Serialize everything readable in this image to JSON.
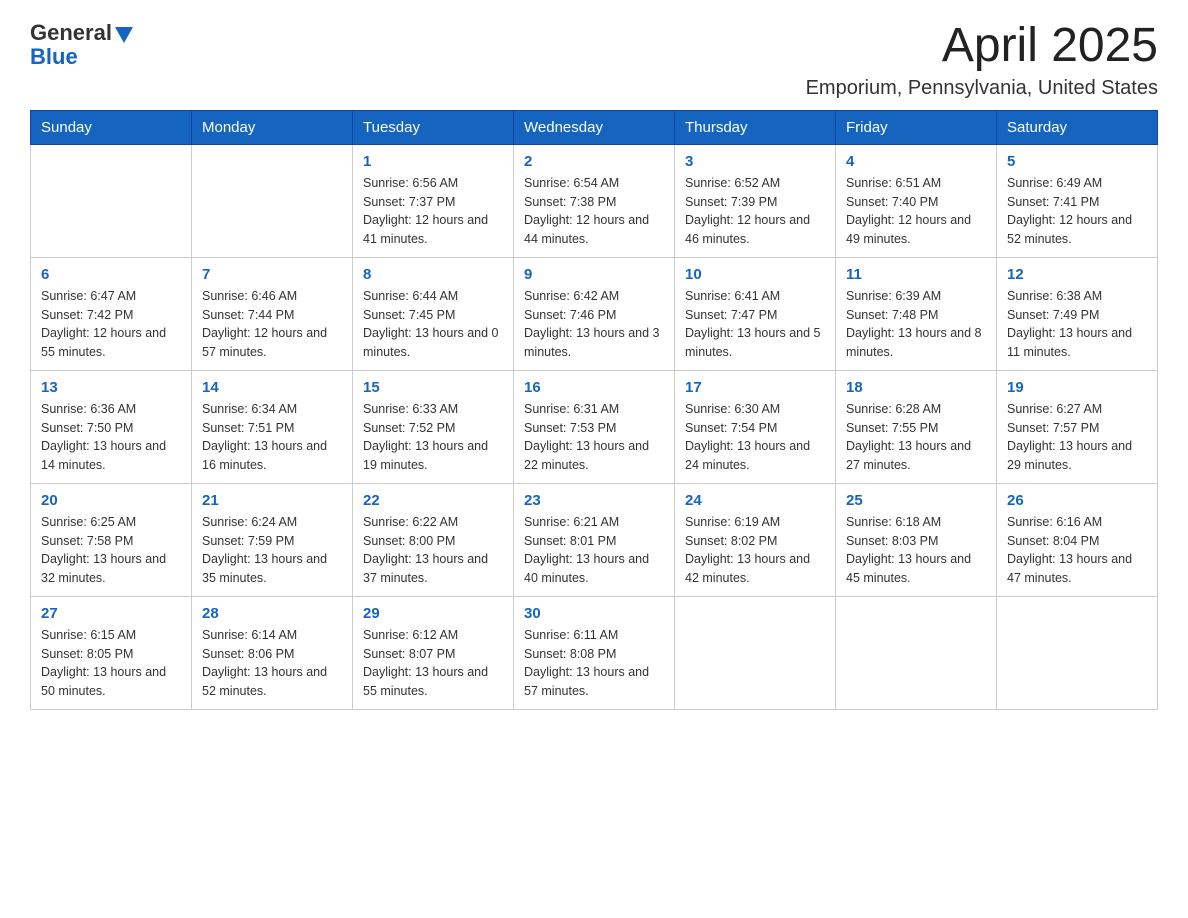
{
  "header": {
    "logo": {
      "general": "General",
      "blue": "Blue"
    },
    "month": "April 2025",
    "location": "Emporium, Pennsylvania, United States"
  },
  "weekdays": [
    "Sunday",
    "Monday",
    "Tuesday",
    "Wednesday",
    "Thursday",
    "Friday",
    "Saturday"
  ],
  "weeks": [
    [
      {
        "day": "",
        "sunrise": "",
        "sunset": "",
        "daylight": ""
      },
      {
        "day": "",
        "sunrise": "",
        "sunset": "",
        "daylight": ""
      },
      {
        "day": "1",
        "sunrise": "Sunrise: 6:56 AM",
        "sunset": "Sunset: 7:37 PM",
        "daylight": "Daylight: 12 hours and 41 minutes."
      },
      {
        "day": "2",
        "sunrise": "Sunrise: 6:54 AM",
        "sunset": "Sunset: 7:38 PM",
        "daylight": "Daylight: 12 hours and 44 minutes."
      },
      {
        "day": "3",
        "sunrise": "Sunrise: 6:52 AM",
        "sunset": "Sunset: 7:39 PM",
        "daylight": "Daylight: 12 hours and 46 minutes."
      },
      {
        "day": "4",
        "sunrise": "Sunrise: 6:51 AM",
        "sunset": "Sunset: 7:40 PM",
        "daylight": "Daylight: 12 hours and 49 minutes."
      },
      {
        "day": "5",
        "sunrise": "Sunrise: 6:49 AM",
        "sunset": "Sunset: 7:41 PM",
        "daylight": "Daylight: 12 hours and 52 minutes."
      }
    ],
    [
      {
        "day": "6",
        "sunrise": "Sunrise: 6:47 AM",
        "sunset": "Sunset: 7:42 PM",
        "daylight": "Daylight: 12 hours and 55 minutes."
      },
      {
        "day": "7",
        "sunrise": "Sunrise: 6:46 AM",
        "sunset": "Sunset: 7:44 PM",
        "daylight": "Daylight: 12 hours and 57 minutes."
      },
      {
        "day": "8",
        "sunrise": "Sunrise: 6:44 AM",
        "sunset": "Sunset: 7:45 PM",
        "daylight": "Daylight: 13 hours and 0 minutes."
      },
      {
        "day": "9",
        "sunrise": "Sunrise: 6:42 AM",
        "sunset": "Sunset: 7:46 PM",
        "daylight": "Daylight: 13 hours and 3 minutes."
      },
      {
        "day": "10",
        "sunrise": "Sunrise: 6:41 AM",
        "sunset": "Sunset: 7:47 PM",
        "daylight": "Daylight: 13 hours and 5 minutes."
      },
      {
        "day": "11",
        "sunrise": "Sunrise: 6:39 AM",
        "sunset": "Sunset: 7:48 PM",
        "daylight": "Daylight: 13 hours and 8 minutes."
      },
      {
        "day": "12",
        "sunrise": "Sunrise: 6:38 AM",
        "sunset": "Sunset: 7:49 PM",
        "daylight": "Daylight: 13 hours and 11 minutes."
      }
    ],
    [
      {
        "day": "13",
        "sunrise": "Sunrise: 6:36 AM",
        "sunset": "Sunset: 7:50 PM",
        "daylight": "Daylight: 13 hours and 14 minutes."
      },
      {
        "day": "14",
        "sunrise": "Sunrise: 6:34 AM",
        "sunset": "Sunset: 7:51 PM",
        "daylight": "Daylight: 13 hours and 16 minutes."
      },
      {
        "day": "15",
        "sunrise": "Sunrise: 6:33 AM",
        "sunset": "Sunset: 7:52 PM",
        "daylight": "Daylight: 13 hours and 19 minutes."
      },
      {
        "day": "16",
        "sunrise": "Sunrise: 6:31 AM",
        "sunset": "Sunset: 7:53 PM",
        "daylight": "Daylight: 13 hours and 22 minutes."
      },
      {
        "day": "17",
        "sunrise": "Sunrise: 6:30 AM",
        "sunset": "Sunset: 7:54 PM",
        "daylight": "Daylight: 13 hours and 24 minutes."
      },
      {
        "day": "18",
        "sunrise": "Sunrise: 6:28 AM",
        "sunset": "Sunset: 7:55 PM",
        "daylight": "Daylight: 13 hours and 27 minutes."
      },
      {
        "day": "19",
        "sunrise": "Sunrise: 6:27 AM",
        "sunset": "Sunset: 7:57 PM",
        "daylight": "Daylight: 13 hours and 29 minutes."
      }
    ],
    [
      {
        "day": "20",
        "sunrise": "Sunrise: 6:25 AM",
        "sunset": "Sunset: 7:58 PM",
        "daylight": "Daylight: 13 hours and 32 minutes."
      },
      {
        "day": "21",
        "sunrise": "Sunrise: 6:24 AM",
        "sunset": "Sunset: 7:59 PM",
        "daylight": "Daylight: 13 hours and 35 minutes."
      },
      {
        "day": "22",
        "sunrise": "Sunrise: 6:22 AM",
        "sunset": "Sunset: 8:00 PM",
        "daylight": "Daylight: 13 hours and 37 minutes."
      },
      {
        "day": "23",
        "sunrise": "Sunrise: 6:21 AM",
        "sunset": "Sunset: 8:01 PM",
        "daylight": "Daylight: 13 hours and 40 minutes."
      },
      {
        "day": "24",
        "sunrise": "Sunrise: 6:19 AM",
        "sunset": "Sunset: 8:02 PM",
        "daylight": "Daylight: 13 hours and 42 minutes."
      },
      {
        "day": "25",
        "sunrise": "Sunrise: 6:18 AM",
        "sunset": "Sunset: 8:03 PM",
        "daylight": "Daylight: 13 hours and 45 minutes."
      },
      {
        "day": "26",
        "sunrise": "Sunrise: 6:16 AM",
        "sunset": "Sunset: 8:04 PM",
        "daylight": "Daylight: 13 hours and 47 minutes."
      }
    ],
    [
      {
        "day": "27",
        "sunrise": "Sunrise: 6:15 AM",
        "sunset": "Sunset: 8:05 PM",
        "daylight": "Daylight: 13 hours and 50 minutes."
      },
      {
        "day": "28",
        "sunrise": "Sunrise: 6:14 AM",
        "sunset": "Sunset: 8:06 PM",
        "daylight": "Daylight: 13 hours and 52 minutes."
      },
      {
        "day": "29",
        "sunrise": "Sunrise: 6:12 AM",
        "sunset": "Sunset: 8:07 PM",
        "daylight": "Daylight: 13 hours and 55 minutes."
      },
      {
        "day": "30",
        "sunrise": "Sunrise: 6:11 AM",
        "sunset": "Sunset: 8:08 PM",
        "daylight": "Daylight: 13 hours and 57 minutes."
      },
      {
        "day": "",
        "sunrise": "",
        "sunset": "",
        "daylight": ""
      },
      {
        "day": "",
        "sunrise": "",
        "sunset": "",
        "daylight": ""
      },
      {
        "day": "",
        "sunrise": "",
        "sunset": "",
        "daylight": ""
      }
    ]
  ]
}
